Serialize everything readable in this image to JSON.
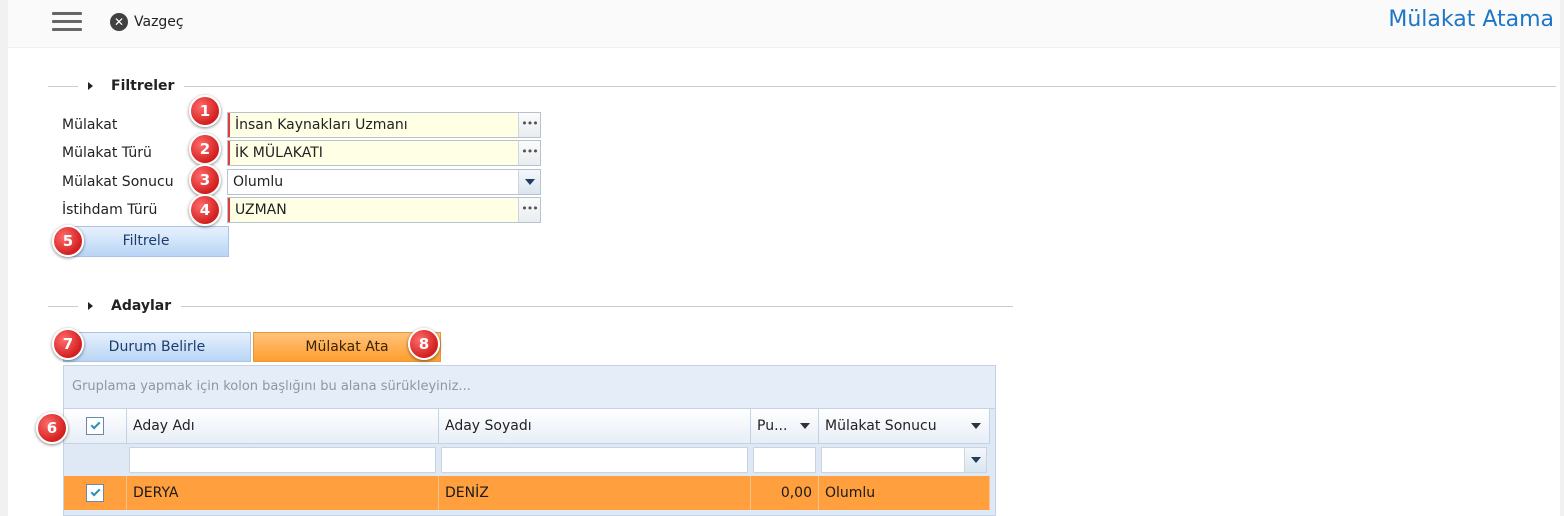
{
  "header": {
    "cancel_label": "Vazgeç",
    "title": "Mülakat Atama"
  },
  "filters": {
    "section_title": "Filtreler",
    "fields": [
      {
        "label": "Mülakat",
        "value": "İnsan Kaynakları Uzmanı",
        "type": "lookup"
      },
      {
        "label": "Mülakat Türü",
        "value": "İK MÜLAKATI",
        "type": "lookup"
      },
      {
        "label": "Mülakat Sonucu",
        "value": "Olumlu",
        "type": "dropdown"
      },
      {
        "label": "İstihdam Türü",
        "value": "UZMAN",
        "type": "lookup"
      }
    ],
    "filter_button": "Filtrele"
  },
  "candidates": {
    "section_title": "Adaylar",
    "set_status_button": "Durum Belirle",
    "assign_button": "Mülakat Ata",
    "group_panel_text": "Gruplama yapmak için kolon başlığını bu alana sürükleyiniz...",
    "columns": [
      "Aday Adı",
      "Aday Soyadı",
      "Pu...",
      "Mülakat Sonucu"
    ],
    "rows": [
      {
        "checked": true,
        "first_name": "DERYA",
        "last_name": "DENİZ",
        "score": "0,00",
        "result": "Olumlu"
      }
    ]
  },
  "markers": [
    "1",
    "2",
    "3",
    "4",
    "5",
    "6",
    "7",
    "8"
  ],
  "colors": {
    "title_blue": "#1d76c6",
    "selected_row": "#ff9f3d",
    "marker_red": "#d21f1f",
    "required_yellow": "#ffffe6"
  }
}
